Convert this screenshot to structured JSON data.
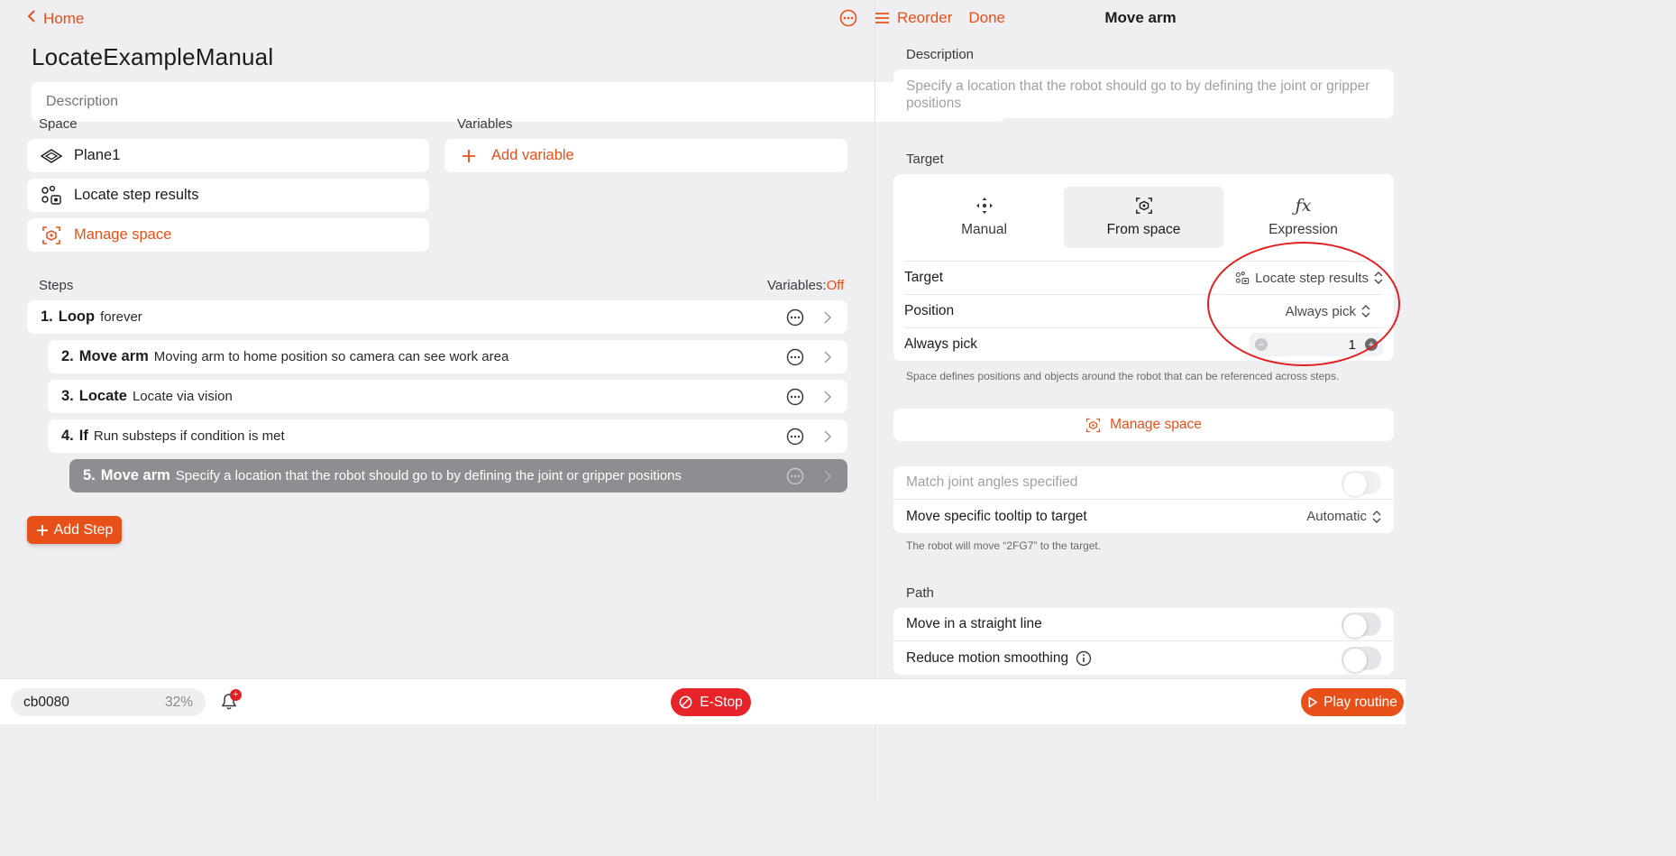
{
  "header": {
    "back_label": "Home",
    "reorder_label": "Reorder",
    "done_label": "Done"
  },
  "routine": {
    "title": "LocateExampleManual",
    "description_placeholder": "Description"
  },
  "space": {
    "label": "Space",
    "items": [
      {
        "label": "Plane1",
        "icon": "plane-icon"
      },
      {
        "label": "Locate step results",
        "icon": "locate-results-icon"
      }
    ],
    "manage_label": "Manage space"
  },
  "variables": {
    "label": "Variables",
    "add_label": "Add variable"
  },
  "steps": {
    "label": "Steps",
    "variables_toggle_label": "Variables:",
    "variables_toggle_value": "Off",
    "items": [
      {
        "num": "1.",
        "name": "Loop",
        "sub": "forever"
      },
      {
        "num": "2.",
        "name": "Move arm",
        "sub": "Moving arm to home position so camera can see work area"
      },
      {
        "num": "3.",
        "name": "Locate",
        "sub": "Locate via vision"
      },
      {
        "num": "4.",
        "name": "If",
        "sub": "Run substeps if condition is met"
      },
      {
        "num": "5.",
        "name": "Move arm",
        "sub": "Specify a location that the robot should go to by defining the joint or gripper positions"
      }
    ],
    "add_label": "Add Step"
  },
  "panel": {
    "title": "Move arm",
    "description_label": "Description",
    "description_text": "Specify a location that the robot should go to by defining the joint or gripper positions",
    "target_label": "Target",
    "modes": [
      {
        "label": "Manual",
        "icon": "manual-move-icon"
      },
      {
        "label": "From space",
        "icon": "from-space-icon"
      },
      {
        "label": "Expression",
        "icon": "function-icon"
      }
    ],
    "active_mode": "From space",
    "target_row": {
      "label": "Target",
      "value": "Locate step results"
    },
    "position_row": {
      "label": "Position",
      "value": "Always pick"
    },
    "always_pick_row": {
      "label": "Always pick",
      "value": "1"
    },
    "space_note": "Space defines positions and objects around the robot that can be referenced across steps.",
    "manage_label": "Manage space",
    "match_joint_label": "Match joint angles specified",
    "tooltip_row": {
      "label": "Move specific tooltip to target",
      "value": "Automatic"
    },
    "tooltip_note": "The robot will move “2FG7” to the target.",
    "path_label": "Path",
    "straight_line_label": "Move in a straight line",
    "reduce_smoothing_label": "Reduce motion smoothing"
  },
  "footer": {
    "device_name": "cb0080",
    "device_pct": "32%",
    "notification_count": "+",
    "estop_label": "E-Stop",
    "play_label": "Play routine"
  },
  "colors": {
    "accent": "#e8501a",
    "estop": "#e8242b",
    "annotation": "#e02020"
  }
}
